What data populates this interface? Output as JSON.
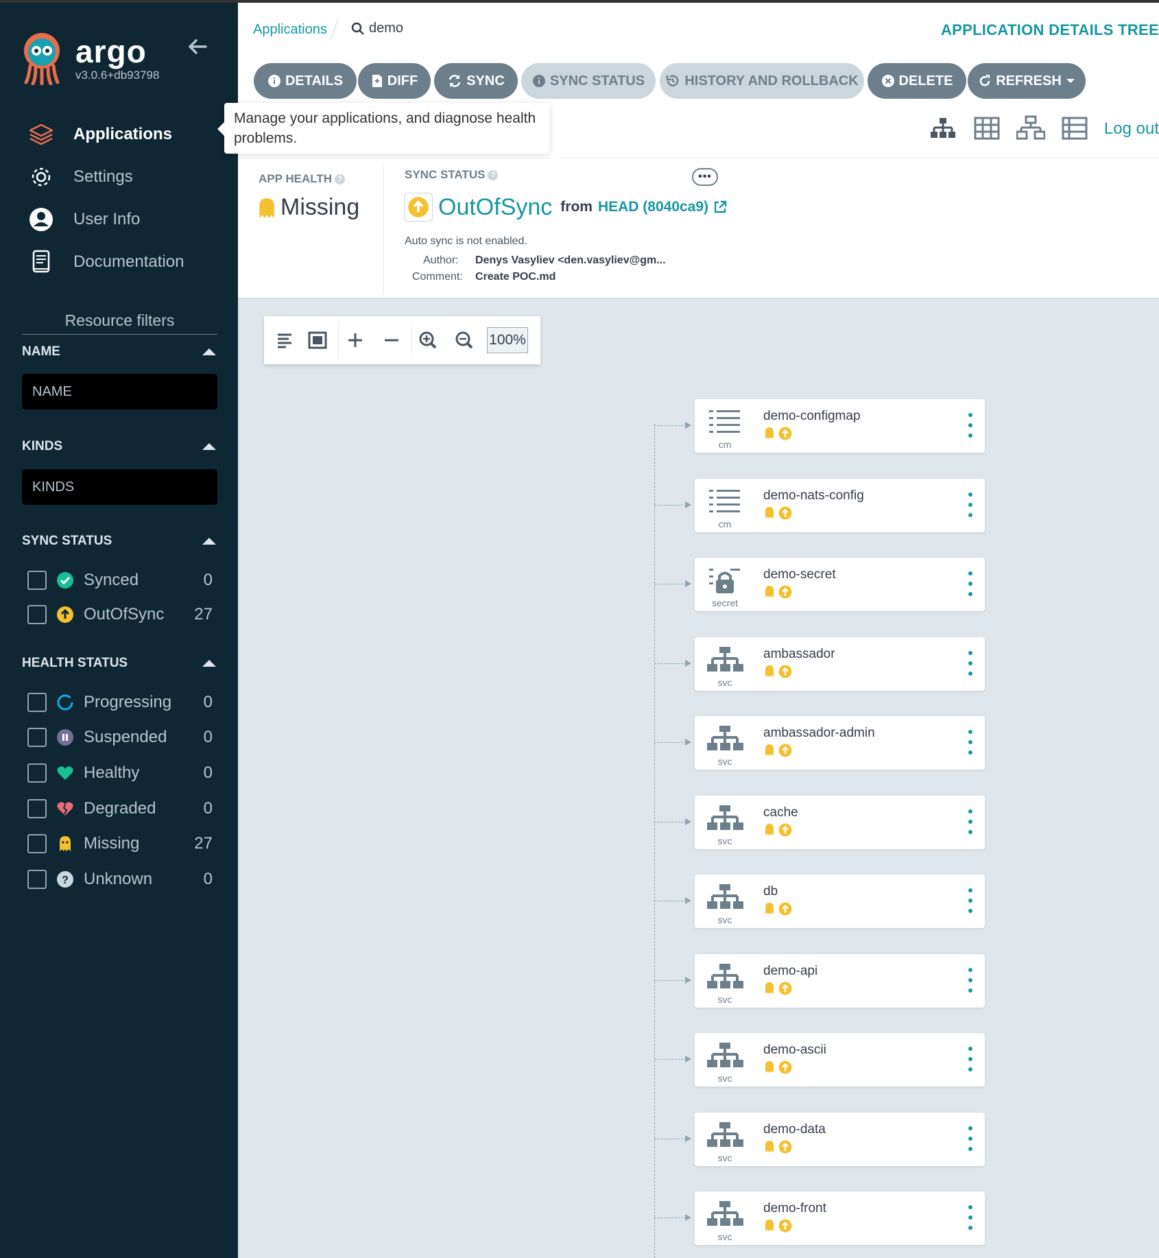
{
  "sidebar": {
    "brand": "argo",
    "version": "v3.0.6+db93798",
    "nav": [
      {
        "label": "Applications",
        "icon": "stack-icon",
        "active": true
      },
      {
        "label": "Settings",
        "icon": "gear-icon",
        "active": false
      },
      {
        "label": "User Info",
        "icon": "user-icon",
        "active": false
      },
      {
        "label": "Documentation",
        "icon": "book-icon",
        "active": false
      }
    ],
    "filters_title": "Resource filters",
    "name_filter": {
      "title": "NAME",
      "placeholder": "NAME"
    },
    "kinds_filter": {
      "title": "KINDS",
      "placeholder": "KINDS"
    },
    "sync_status": {
      "title": "SYNC STATUS",
      "items": [
        {
          "label": "Synced",
          "count": "0",
          "icon": "synced-icon",
          "color": "#18be94"
        },
        {
          "label": "OutOfSync",
          "count": "27",
          "icon": "out-of-sync-icon",
          "color": "#f4c030"
        }
      ]
    },
    "health_status": {
      "title": "HEALTH STATUS",
      "items": [
        {
          "label": "Progressing",
          "count": "0",
          "icon": "progressing-icon",
          "color": "#0dadea"
        },
        {
          "label": "Suspended",
          "count": "0",
          "icon": "suspended-icon",
          "color": "#766f94"
        },
        {
          "label": "Healthy",
          "count": "0",
          "icon": "heart-icon",
          "color": "#18be94"
        },
        {
          "label": "Degraded",
          "count": "0",
          "icon": "heart-broken-icon",
          "color": "#e96d76"
        },
        {
          "label": "Missing",
          "count": "27",
          "icon": "ghost-icon",
          "color": "#f4c030"
        },
        {
          "label": "Unknown",
          "count": "0",
          "icon": "question-icon",
          "color": "#ccd6dd"
        }
      ]
    }
  },
  "header": {
    "breadcrumb_link": "Applications",
    "search_text": "demo",
    "title": "APPLICATION DETAILS TREE"
  },
  "toolbar": {
    "buttons": [
      {
        "label": "DETAILS",
        "icon": "info-icon"
      },
      {
        "label": "DIFF",
        "icon": "file-diff-icon"
      },
      {
        "label": "SYNC",
        "icon": "sync-icon"
      },
      {
        "label": "SYNC STATUS",
        "icon": "info-icon"
      },
      {
        "label": "HISTORY AND ROLLBACK",
        "icon": "history-icon"
      },
      {
        "label": "DELETE",
        "icon": "close-circle-icon"
      },
      {
        "label": "REFRESH",
        "icon": "refresh-icon"
      }
    ],
    "tooltip": "Manage your applications, and diagnose health problems.",
    "logout": "Log out",
    "view_icons": [
      "tree-view-icon",
      "pods-view-icon",
      "network-view-icon",
      "list-view-icon"
    ]
  },
  "status": {
    "app_health_label": "APP HEALTH",
    "app_health_value": "Missing",
    "sync_status_label": "SYNC STATUS",
    "sync_status_value": "OutOfSync",
    "from_text": "from",
    "revision": "HEAD (8040ca9)",
    "more_label": "•••",
    "auto_sync": "Auto sync is not enabled.",
    "author_label": "Author:",
    "author_value": "Denys Vasyliev <den.vasyliev@gm...",
    "comment_label": "Comment:",
    "comment_value": "Create POC.md"
  },
  "graph": {
    "zoom_level": "100%",
    "nodes": [
      {
        "name": "demo-configmap",
        "kind": "cm",
        "icon": "configmap-icon"
      },
      {
        "name": "demo-nats-config",
        "kind": "cm",
        "icon": "configmap-icon"
      },
      {
        "name": "demo-secret",
        "kind": "secret",
        "icon": "secret-icon"
      },
      {
        "name": "ambassador",
        "kind": "svc",
        "icon": "service-icon"
      },
      {
        "name": "ambassador-admin",
        "kind": "svc",
        "icon": "service-icon"
      },
      {
        "name": "cache",
        "kind": "svc",
        "icon": "service-icon"
      },
      {
        "name": "db",
        "kind": "svc",
        "icon": "service-icon"
      },
      {
        "name": "demo-api",
        "kind": "svc",
        "icon": "service-icon"
      },
      {
        "name": "demo-ascii",
        "kind": "svc",
        "icon": "service-icon"
      },
      {
        "name": "demo-data",
        "kind": "svc",
        "icon": "service-icon"
      },
      {
        "name": "demo-front",
        "kind": "svc",
        "icon": "service-icon"
      }
    ]
  },
  "colors": {
    "sidebar_bg": "#0f2733",
    "accent": "#1797a0",
    "button_bg": "#6d7f8b",
    "button_light_bg": "#ccd6dd",
    "missing": "#f4c030",
    "canvas_bg": "#dee6eb"
  }
}
